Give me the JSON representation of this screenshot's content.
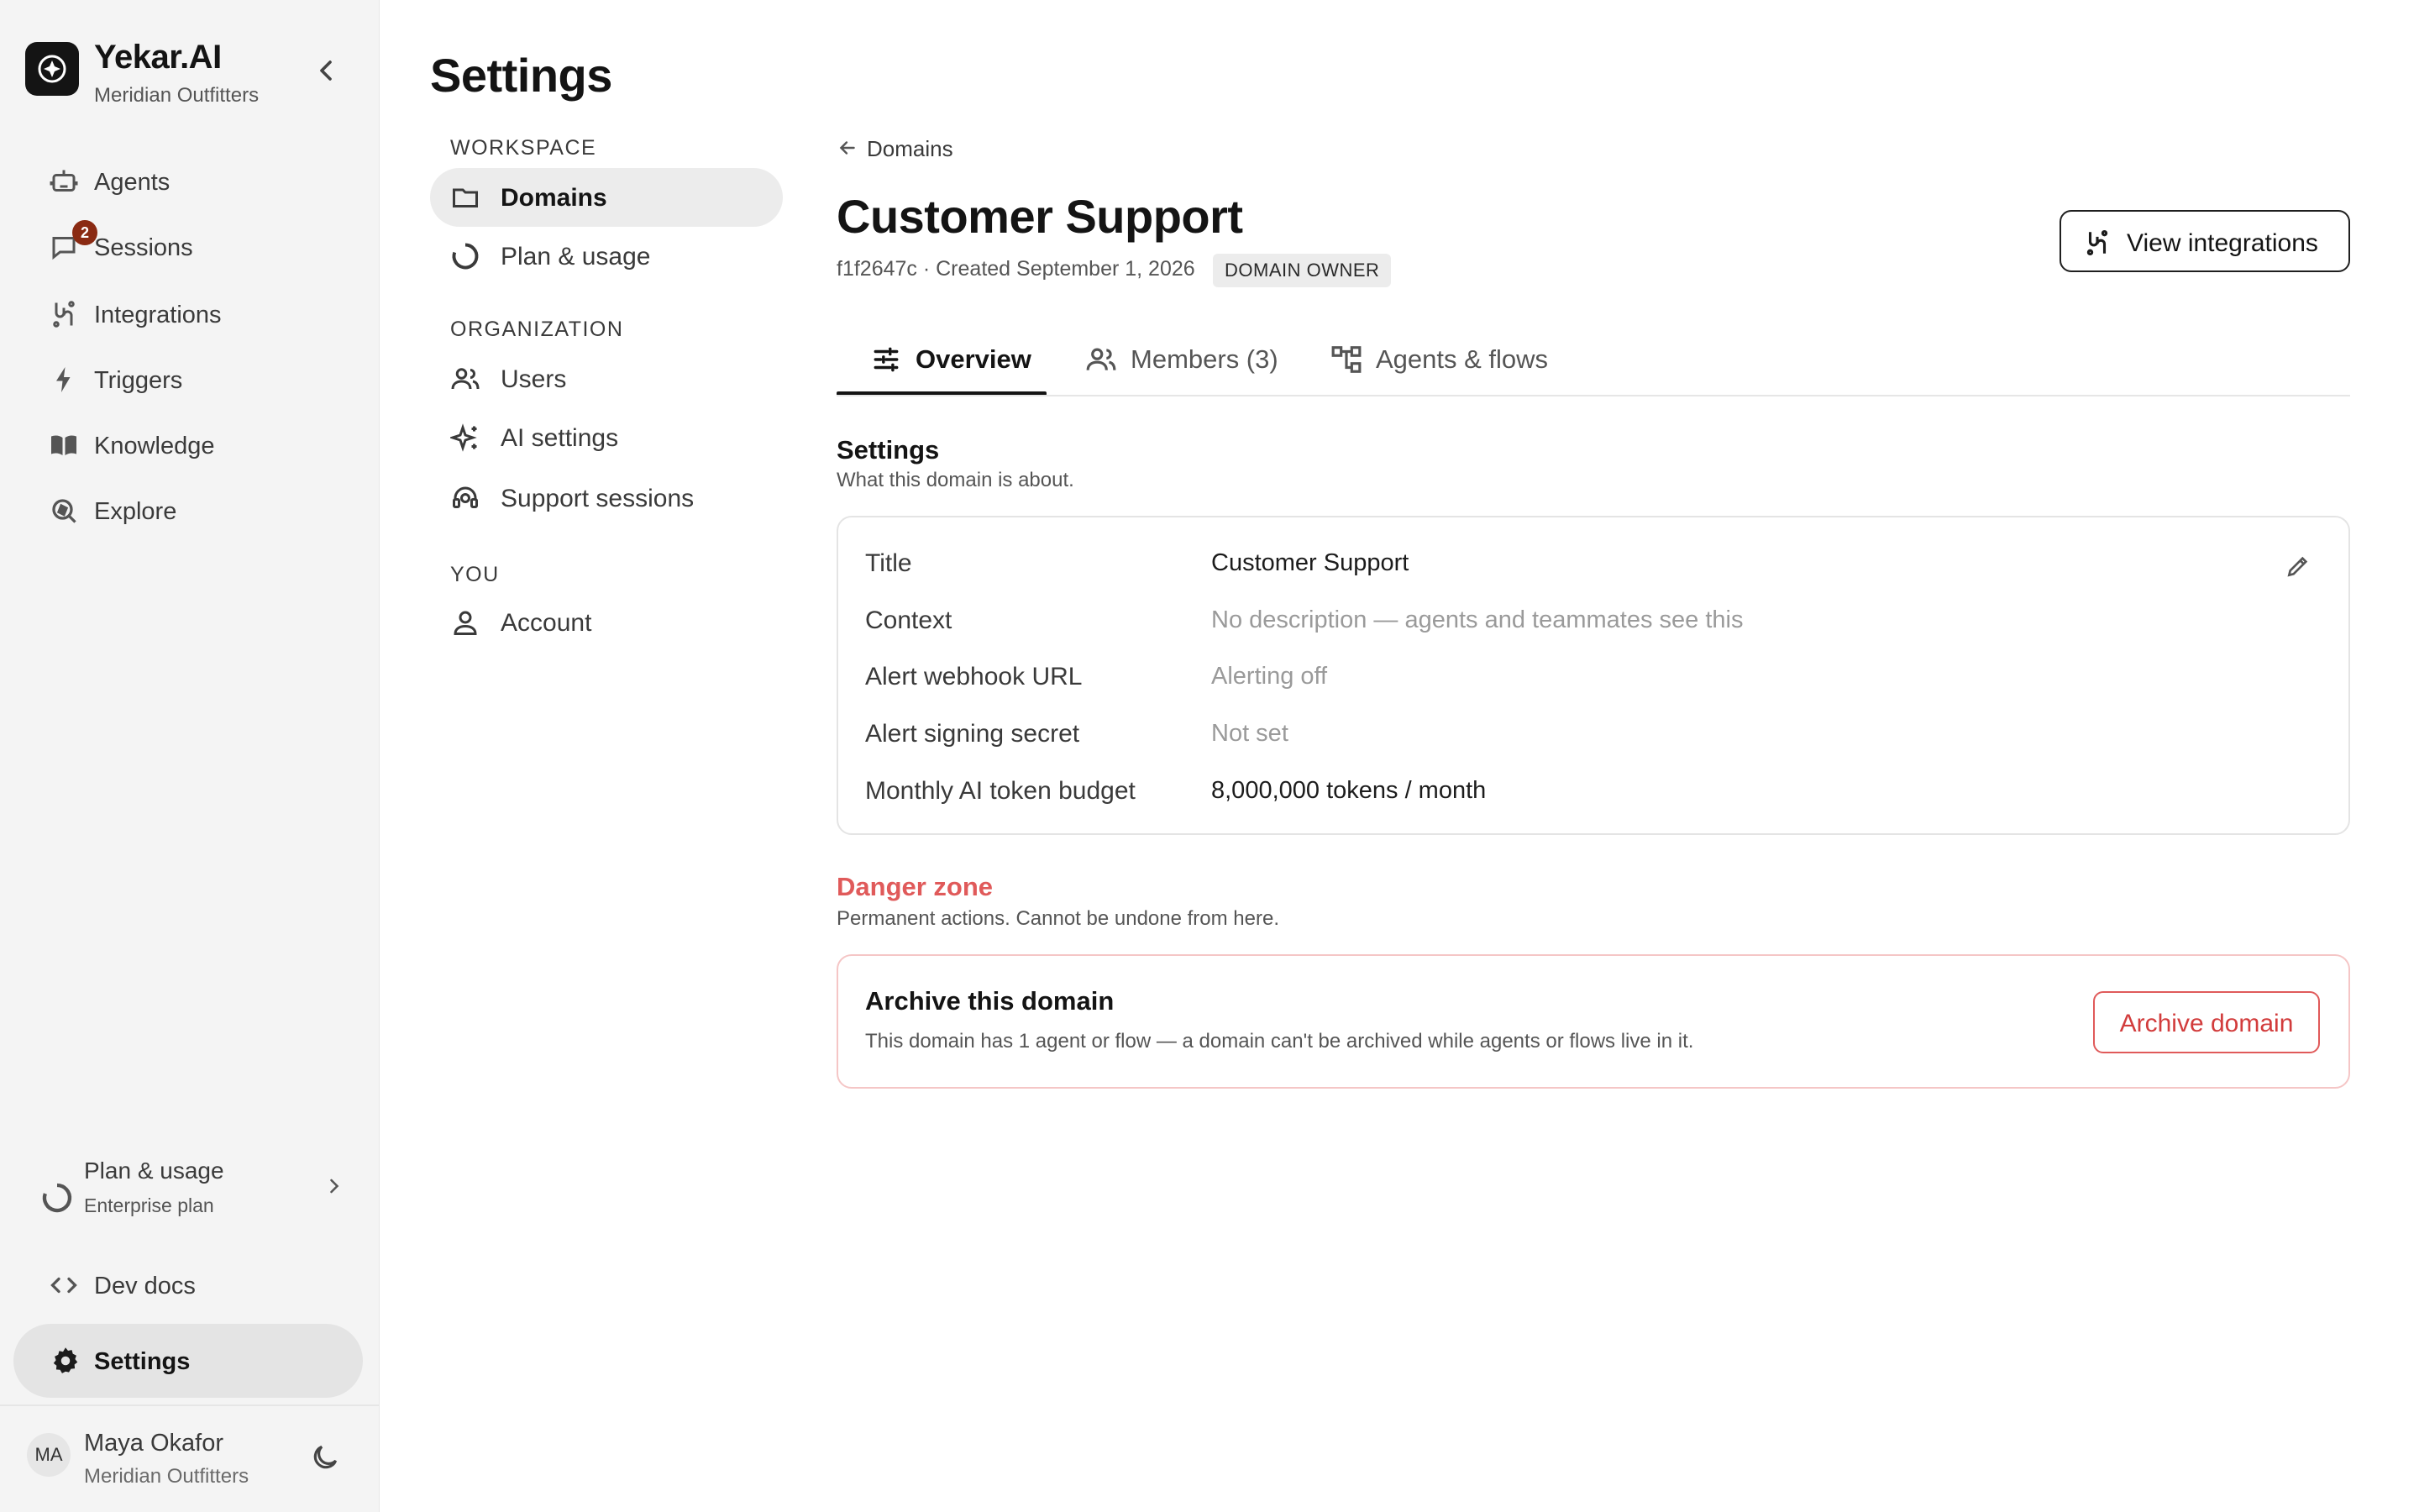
{
  "brand": {
    "name": "Yekar.AI",
    "org": "Meridian Outfitters"
  },
  "sidebar": {
    "items": [
      {
        "label": "Agents",
        "icon": "robot-icon"
      },
      {
        "label": "Sessions",
        "icon": "chat-icon",
        "badge": "2"
      },
      {
        "label": "Integrations",
        "icon": "integrations-icon"
      },
      {
        "label": "Triggers",
        "icon": "bolt-icon"
      },
      {
        "label": "Knowledge",
        "icon": "book-icon"
      },
      {
        "label": "Explore",
        "icon": "explore-icon"
      }
    ],
    "plan": {
      "title": "Plan & usage",
      "subtitle": "Enterprise plan"
    },
    "devdocs": "Dev docs",
    "settings": "Settings",
    "user": {
      "initials": "MA",
      "name": "Maya Okafor",
      "org": "Meridian Outfitters"
    }
  },
  "settings_nav": {
    "title": "Settings",
    "workspace_heading": "WORKSPACE",
    "workspace_items": [
      {
        "label": "Domains",
        "icon": "folder-icon",
        "active": true
      },
      {
        "label": "Plan & usage",
        "icon": "usage-ring-icon"
      }
    ],
    "organization_heading": "ORGANIZATION",
    "organization_items": [
      {
        "label": "Users",
        "icon": "users-icon"
      },
      {
        "label": "AI settings",
        "icon": "sparkles-icon"
      },
      {
        "label": "Support sessions",
        "icon": "support-icon"
      }
    ],
    "you_heading": "YOU",
    "you_items": [
      {
        "label": "Account",
        "icon": "person-icon"
      }
    ]
  },
  "main": {
    "breadcrumb": "Domains",
    "title": "Customer Support",
    "meta": "f1f2647c · Created September 1, 2026",
    "owner_badge": "DOMAIN OWNER",
    "view_integrations": "View integrations",
    "tabs": [
      {
        "label": "Overview",
        "icon": "sliders-icon",
        "active": true
      },
      {
        "label": "Members (3)",
        "icon": "users-icon"
      },
      {
        "label": "Agents & flows",
        "icon": "flow-icon"
      }
    ],
    "settings": {
      "title": "Settings",
      "description": "What this domain is about.",
      "fields": [
        {
          "label": "Title",
          "value": "Customer Support",
          "muted": false
        },
        {
          "label": "Context",
          "value": "No description — agents and teammates see this",
          "muted": true
        },
        {
          "label": "Alert webhook URL",
          "value": "Alerting off",
          "muted": true
        },
        {
          "label": "Alert signing secret",
          "value": "Not set",
          "muted": true
        },
        {
          "label": "Monthly AI token budget",
          "value": "8,000,000 tokens / month",
          "muted": false
        }
      ]
    },
    "danger": {
      "title": "Danger zone",
      "description": "Permanent actions. Cannot be undone from here.",
      "archive_title": "Archive this domain",
      "archive_description": "This domain has 1 agent or flow — a domain can't be archived while agents or flows live in it.",
      "archive_button": "Archive domain"
    }
  },
  "colors": {
    "accent": "#141414",
    "danger": "#e05a5a",
    "badge": "#8a2a12"
  }
}
